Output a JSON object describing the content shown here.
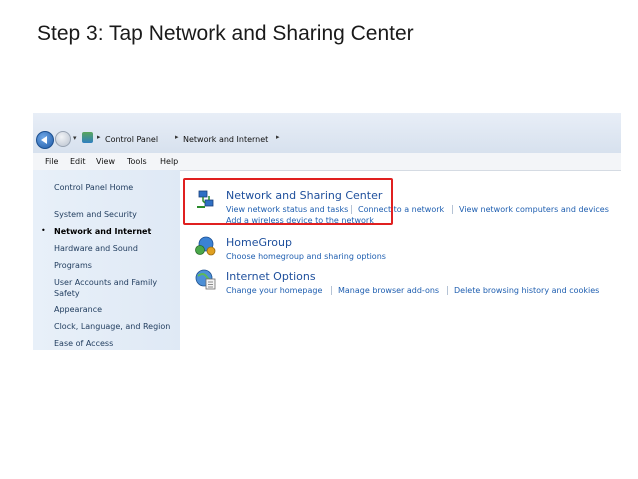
{
  "slide": {
    "title": "Step 3: Tap Network and Sharing Center"
  },
  "window": {
    "breadcrumb": [
      "Control Panel",
      "Network and Internet"
    ],
    "menu": [
      "File",
      "Edit",
      "View",
      "Tools",
      "Help"
    ],
    "left_nav": {
      "home": "Control Panel Home",
      "items": [
        "System and Security",
        "Network and Internet",
        "Hardware and Sound",
        "Programs",
        "User Accounts and Family",
        "Safety",
        "Appearance",
        "Clock, Language, and Region",
        "Ease of Access"
      ],
      "active_index": 1
    },
    "categories": [
      {
        "title": "Network and Sharing Center",
        "links": [
          "View network status and tasks",
          "Connect to a network",
          "View network computers and devices"
        ],
        "links2": [
          "Add a wireless device to the network"
        ],
        "icon": "network-icon",
        "highlighted": true
      },
      {
        "title": "HomeGroup",
        "links": [
          "Choose homegroup and sharing options"
        ],
        "icon": "homegroup-icon"
      },
      {
        "title": "Internet Options",
        "links": [
          "Change your homepage",
          "Manage browser add-ons",
          "Delete browsing history and cookies"
        ],
        "icon": "internet-options-icon"
      }
    ]
  },
  "colors": {
    "highlight": "#e02020",
    "link": "#1e5eb0",
    "title_link": "#1e4f9c"
  }
}
